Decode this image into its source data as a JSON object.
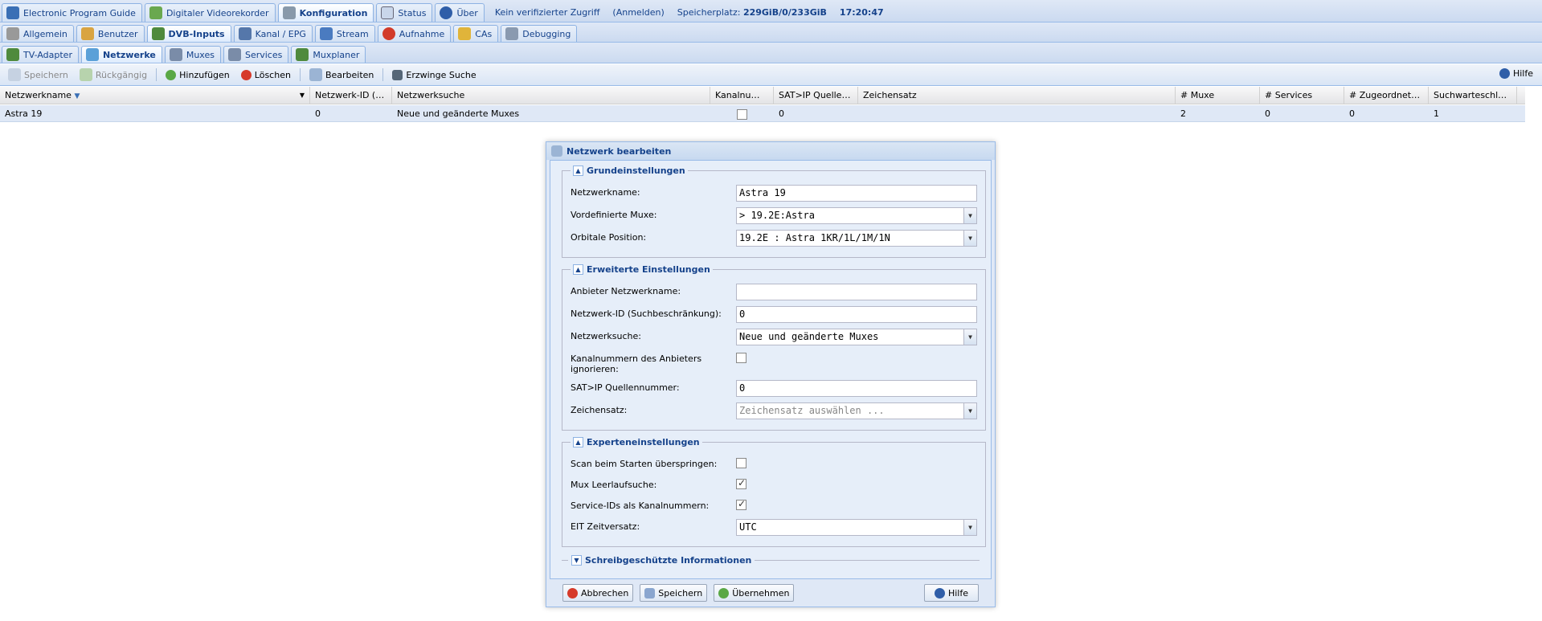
{
  "colors": {
    "accent": "#15428b",
    "selected_row": "#dfe8f6",
    "border": "#99bbe8"
  },
  "top_tabs": [
    {
      "label": "Electronic Program Guide",
      "icon": "epg-icon"
    },
    {
      "label": "Digitaler Videorekorder",
      "icon": "download-icon"
    },
    {
      "label": "Konfiguration",
      "icon": "wrench-icon",
      "active": true
    },
    {
      "label": "Status",
      "icon": "eye-icon"
    },
    {
      "label": "Über",
      "icon": "info-icon"
    }
  ],
  "status_bar": {
    "access": "Kein verifizierter Zugriff",
    "login": "(Anmelden)",
    "storage_label": "Speicherplatz:",
    "storage_value": "229GiB/0/233GiB",
    "time": "17:20:47"
  },
  "config_tabs": [
    {
      "label": "Allgemein",
      "icon": "tools-icon"
    },
    {
      "label": "Benutzer",
      "icon": "users-icon"
    },
    {
      "label": "DVB-Inputs",
      "icon": "tv-card-icon",
      "active": true
    },
    {
      "label": "Kanal / EPG",
      "icon": "tv-icon"
    },
    {
      "label": "Stream",
      "icon": "stream-icon"
    },
    {
      "label": "Aufnahme",
      "icon": "record-icon"
    },
    {
      "label": "CAs",
      "icon": "key-icon"
    },
    {
      "label": "Debugging",
      "icon": "gears-icon"
    }
  ],
  "dvb_tabs": [
    {
      "label": "TV-Adapter",
      "icon": "adapter-icon"
    },
    {
      "label": "Netzwerke",
      "icon": "network-icon",
      "active": true
    },
    {
      "label": "Muxes",
      "icon": "muxes-icon"
    },
    {
      "label": "Services",
      "icon": "services-icon"
    },
    {
      "label": "Muxplaner",
      "icon": "scheduler-icon"
    }
  ],
  "toolbar": {
    "save": "Speichern",
    "undo": "Rückgängig",
    "add": "Hinzufügen",
    "delete": "Löschen",
    "edit": "Bearbeiten",
    "force_scan": "Erzwinge Suche",
    "help": "Hilfe"
  },
  "grid": {
    "columns": [
      "Netzwerkname",
      "Netzwerk-ID (Su...",
      "Netzwerksuche",
      "Kanalnumm...",
      "SAT>IP Quellenn...",
      "Zeichensatz",
      "# Muxe",
      "# Services",
      "# Zugeordnete K...",
      "Suchwarteschla..."
    ],
    "rows": [
      {
        "name": "Astra 19",
        "network_id": "0",
        "scan": "Neue und geänderte Muxes",
        "ignore_numbers": false,
        "satip": "0",
        "charset": "",
        "muxes": "2",
        "services": "0",
        "mapped": "0",
        "queue": "1"
      }
    ]
  },
  "dialog": {
    "title": "Netzwerk bearbeiten",
    "basic": {
      "legend": "Grundeinstellungen",
      "name_label": "Netzwerkname:",
      "name_value": "Astra 19",
      "muxes_label": "Vordefinierte Muxe:",
      "muxes_value": "> 19.2E:Astra",
      "orbital_label": "Orbitale Position:",
      "orbital_value": "19.2E : Astra 1KR/1L/1M/1N"
    },
    "advanced": {
      "legend": "Erweiterte Einstellungen",
      "provider_label": "Anbieter Netzwerkname:",
      "provider_value": "",
      "nid_label": "Netzwerk-ID (Suchbeschränkung):",
      "nid_value": "0",
      "scan_label": "Netzwerksuche:",
      "scan_value": "Neue und geänderte Muxes",
      "ignore_label": "Kanalnummern des Anbieters ignorieren:",
      "ignore_checked": false,
      "satip_label": "SAT>IP Quellennummer:",
      "satip_value": "0",
      "charset_label": "Zeichensatz:",
      "charset_placeholder": "Zeichensatz auswählen ..."
    },
    "expert": {
      "legend": "Experteneinstellungen",
      "skip_label": "Scan beim Starten überspringen:",
      "skip_checked": false,
      "idle_label": "Mux Leerlaufsuche:",
      "idle_checked": true,
      "sid_label": "Service-IDs als Kanalnummern:",
      "sid_checked": true,
      "eit_label": "EIT Zeitversatz:",
      "eit_value": "UTC"
    },
    "readonly_legend": "Schreibgeschützte Informationen",
    "buttons": {
      "cancel": "Abbrechen",
      "save": "Speichern",
      "apply": "Übernehmen",
      "help": "Hilfe"
    }
  }
}
